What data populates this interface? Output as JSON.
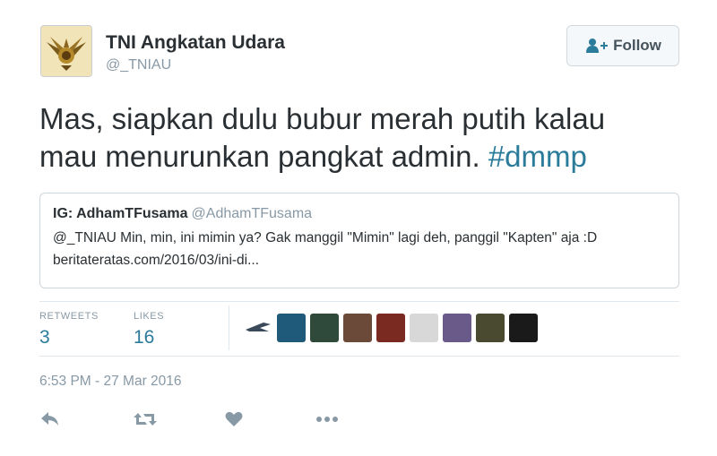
{
  "user": {
    "name": "TNI Angkatan Udara",
    "handle": "@_TNIAU",
    "avatar_icon": "air-force-emblem-icon"
  },
  "follow_button": {
    "label": "Follow",
    "icon": "add-user-icon"
  },
  "tweet": {
    "text": "Mas, siapkan dulu bubur merah putih kalau mau menurunkan pangkat admin.",
    "hashtag": "#dmmp"
  },
  "quoted_tweet": {
    "name": "IG: AdhamTFusama",
    "handle": "@AdhamTFusama",
    "text": "@_TNIAU Min, min, ini mimin ya? Gak manggil \"Mimin\" lagi deh, panggil \"Kapten\" aja :D beritateratas.com/2016/03/ini-di..."
  },
  "stats": {
    "retweets_label": "RETWEETS",
    "retweets_value": "3",
    "likes_label": "LIKES",
    "likes_value": "16"
  },
  "likers": [
    {
      "name": "liker-avatar",
      "color": "#3a4a5a"
    },
    {
      "name": "liker-avatar",
      "color": "#1f5a6a"
    },
    {
      "name": "liker-avatar",
      "color": "#6b4a3a"
    },
    {
      "name": "liker-avatar",
      "color": "#7a2a20"
    },
    {
      "name": "liker-avatar",
      "color": "#2a2a2a"
    },
    {
      "name": "liker-avatar",
      "color": "#6a5a8a"
    },
    {
      "name": "liker-avatar",
      "color": "#5a5a3a"
    },
    {
      "name": "liker-avatar",
      "color": "#1a1a1a"
    }
  ],
  "timestamp": "6:53 PM - 27 Mar 2016",
  "actions": [
    "reply-icon",
    "retweet-icon",
    "like-icon",
    "more-icon"
  ],
  "colors": {
    "link": "#2b7b9a",
    "muted": "#8899a6",
    "text": "#292f33"
  }
}
